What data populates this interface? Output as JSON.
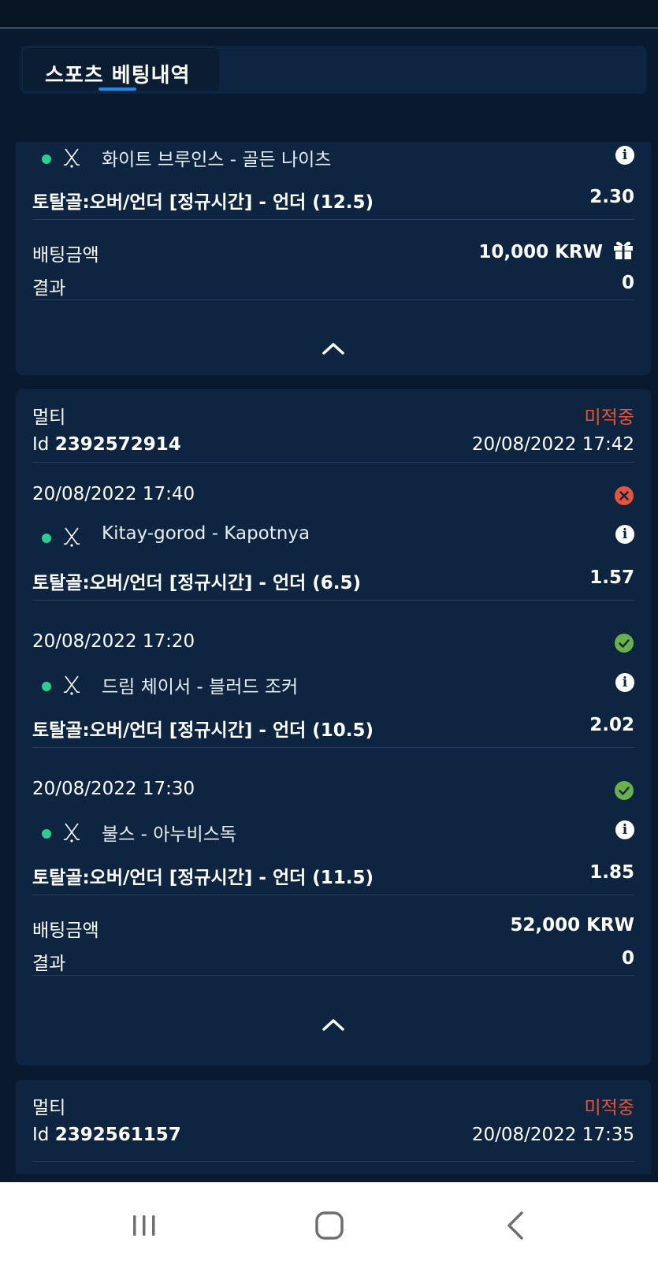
{
  "header": {
    "tab_label": "스포츠 베팅내역"
  },
  "card1": {
    "event": "화이트 브루인스 - 골든 나이츠",
    "market": "토탈골:오버/언더 [정규시간] - 언더 (12.5)",
    "odds": "2.30",
    "stake_label": "배팅금액",
    "stake_value": "10,000 KRW",
    "result_label": "결과",
    "result_value": "0",
    "stake_icon": "gift-icon"
  },
  "card2": {
    "type": "멀티",
    "status": "미적중",
    "id_prefix": "Id",
    "id_value": "2392572914",
    "datetime": "20/08/2022 17:42",
    "legs": [
      {
        "datetime": "20/08/2022 17:40",
        "status_icon": "lost-icon",
        "event": "Kitay-gorod - Kapotnya",
        "market": "토탈골:오버/언더 [정규시간] - 언더 (6.5)",
        "odds": "1.57"
      },
      {
        "datetime": "20/08/2022 17:20",
        "status_icon": "won-icon",
        "event": "드림 체이서 - 블러드 조커",
        "market": "토탈골:오버/언더 [정규시간] - 언더 (10.5)",
        "odds": "2.02"
      },
      {
        "datetime": "20/08/2022 17:30",
        "status_icon": "won-icon",
        "event": "불스 - 아누비스독",
        "market": "토탈골:오버/언더 [정규시간] - 언더 (11.5)",
        "odds": "1.85"
      }
    ],
    "stake_label": "배팅금액",
    "stake_value": "52,000 KRW",
    "result_label": "결과",
    "result_value": "0"
  },
  "card3": {
    "type": "멀티",
    "status": "미적중",
    "id_prefix": "Id",
    "id_value": "2392561157",
    "datetime": "20/08/2022 17:35"
  },
  "colors": {
    "background": "#0a1a2e",
    "card": "#0d2540",
    "accent": "#1e88e5",
    "lost": "#e5533d",
    "won": "#6ab04c",
    "live_dot": "#2ecc8f"
  },
  "icons": {
    "info": "info-icon",
    "sport": "hockey-sticks-icon",
    "collapse": "chevron-up-icon",
    "nav_recents": "recents-icon",
    "nav_home": "home-icon",
    "nav_back": "back-icon"
  }
}
